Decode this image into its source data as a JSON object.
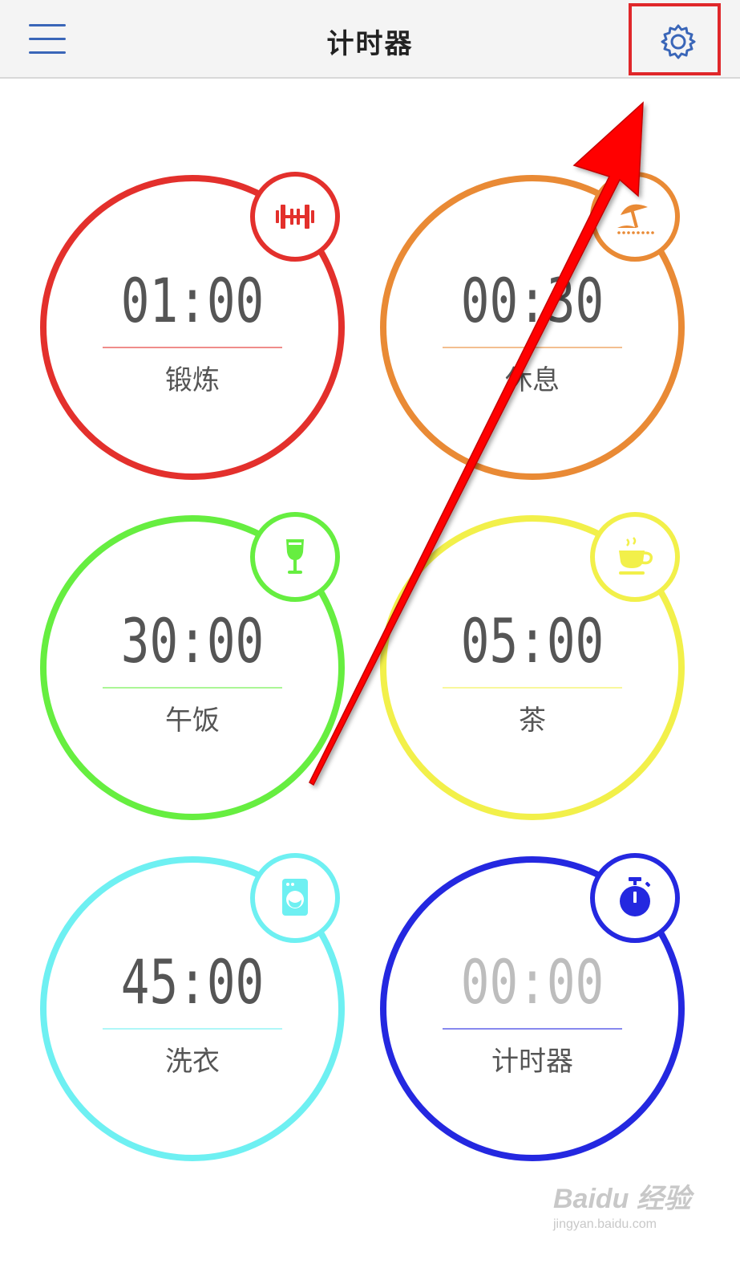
{
  "header": {
    "title": "计时器"
  },
  "timers": [
    {
      "time": "01:00",
      "label": "锻炼",
      "color": "#e3302c",
      "icon": "dumbbell-icon"
    },
    {
      "time": "00:30",
      "label": "休息",
      "color": "#e98a35",
      "icon": "beach-umbrella-icon"
    },
    {
      "time": "30:00",
      "label": "午饭",
      "color": "#66ee40",
      "icon": "wine-glass-icon"
    },
    {
      "time": "05:00",
      "label": "茶",
      "color": "#f2f04a",
      "icon": "coffee-cup-icon"
    },
    {
      "time": "45:00",
      "label": "洗衣",
      "color": "#6ef0f2",
      "icon": "washing-machine-icon"
    },
    {
      "time": "00:00",
      "label": "计时器",
      "color": "#2428e0",
      "icon": "stopwatch-icon"
    }
  ],
  "colors": {
    "menu": "#3a66b8",
    "highlight": "#e0272a",
    "arrow": "#ff0000"
  },
  "watermark": {
    "main": "Baidu 经验",
    "url": "jingyan.baidu.com"
  }
}
